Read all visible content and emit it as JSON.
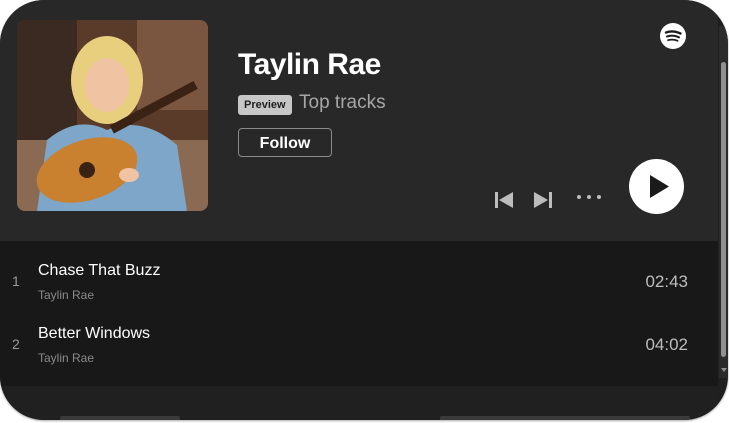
{
  "artist": {
    "name": "Taylin Rae",
    "badge": "Preview",
    "subtitle": "Top tracks",
    "follow_label": "Follow"
  },
  "controls": {
    "previous": "skip-previous-icon",
    "next": "skip-next-icon",
    "more": "more-options-icon",
    "play": "play-icon",
    "brand": "spotify-logo-icon"
  },
  "tracks": [
    {
      "number": "1",
      "title": "Chase That Buzz",
      "artist": "Taylin Rae",
      "duration": "02:43"
    },
    {
      "number": "2",
      "title": "Better Windows",
      "artist": "Taylin Rae",
      "duration": "04:02"
    }
  ],
  "colors": {
    "header_bg": "#282828",
    "list_bg": "#181818",
    "badge_bg": "#c7c7c7",
    "play_button": "#ffffff"
  }
}
